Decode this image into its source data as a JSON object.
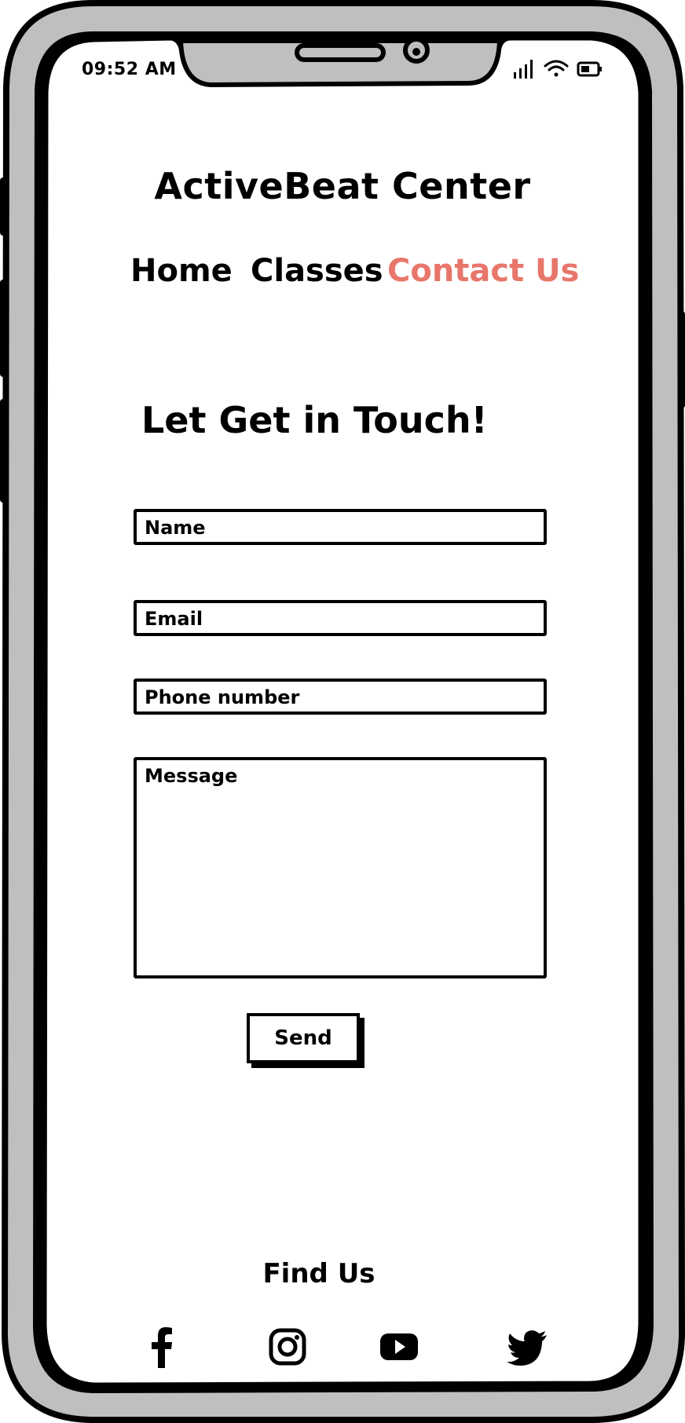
{
  "status_bar": {
    "time": "09:52 AM",
    "icons": [
      "signal-icon",
      "wifi-icon",
      "battery-icon"
    ]
  },
  "app": {
    "title": "ActiveBeat Center",
    "accent_color": "#E8766A"
  },
  "nav": {
    "items": [
      {
        "label": "Home",
        "active": false
      },
      {
        "label": "Classes",
        "active": false
      },
      {
        "label": "Contact Us",
        "active": true
      }
    ]
  },
  "contact": {
    "heading": "Let Get in Touch!",
    "fields": {
      "name_placeholder": "Name",
      "email_placeholder": "Email",
      "phone_placeholder": "Phone number",
      "message_placeholder": "Message"
    },
    "send_label": "Send"
  },
  "footer": {
    "find_us": "Find Us",
    "social": [
      "facebook-icon",
      "instagram-icon",
      "youtube-icon",
      "twitter-icon"
    ]
  }
}
